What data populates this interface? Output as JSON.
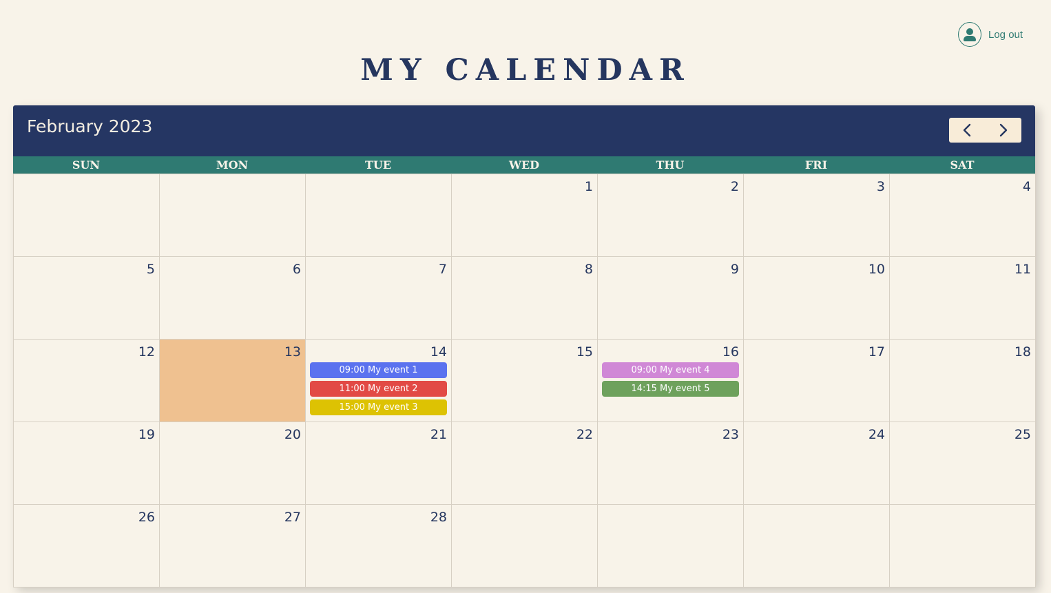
{
  "header": {
    "logout_label": "Log out",
    "page_title": "MY CALENDAR"
  },
  "calendar": {
    "month_label": "February 2023",
    "weekdays": [
      "SUN",
      "MON",
      "TUE",
      "WED",
      "THU",
      "FRI",
      "SAT"
    ],
    "today": 13,
    "days": [
      "",
      "",
      "",
      "1",
      "2",
      "3",
      "4",
      "5",
      "6",
      "7",
      "8",
      "9",
      "10",
      "11",
      "12",
      "13",
      "14",
      "15",
      "16",
      "17",
      "18",
      "19",
      "20",
      "21",
      "22",
      "23",
      "24",
      "25",
      "26",
      "27",
      "28",
      "",
      "",
      "",
      ""
    ],
    "events": [
      {
        "day": "14",
        "label": "09:00 My event 1",
        "color": "#5b72ef"
      },
      {
        "day": "14",
        "label": "11:00 My event 2",
        "color": "#e24a45"
      },
      {
        "day": "14",
        "label": "15:00 My event 3",
        "color": "#ddc203"
      },
      {
        "day": "16",
        "label": "09:00 My event 4",
        "color": "#d088d6"
      },
      {
        "day": "16",
        "label": "14:15 My event 5",
        "color": "#6ea15c"
      }
    ]
  },
  "icons": {
    "user": "user-icon",
    "prev": "chevron-left-icon",
    "next": "chevron-right-icon"
  },
  "colors": {
    "background": "#f8f3e9",
    "header_navy": "#253663",
    "weekday_teal": "#2f7a72",
    "today_highlight": "#efc190"
  }
}
